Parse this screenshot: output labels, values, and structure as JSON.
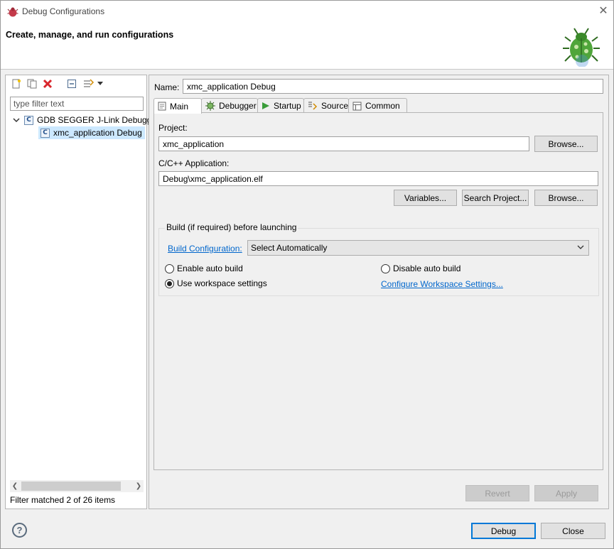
{
  "window": {
    "title": "Debug Configurations",
    "close_glyph": "✕"
  },
  "banner": {
    "heading": "Create, manage, and run configurations"
  },
  "left": {
    "toolbar": [
      "new-config-icon",
      "duplicate-icon",
      "delete-icon",
      "collapse-all-icon",
      "filter-icon",
      "chevron-down-icon"
    ],
    "filter_placeholder": "type filter text",
    "tree": [
      {
        "label": "GDB SEGGER J-Link Debugging",
        "type_glyph": "C",
        "expanded": true,
        "depth": 0
      },
      {
        "label": "xmc_application Debug",
        "type_glyph": "C",
        "selected": true,
        "depth": 1
      }
    ],
    "status": "Filter matched 2 of 26 items"
  },
  "right": {
    "name_label": "Name:",
    "name_value": "xmc_application Debug",
    "tabs": [
      {
        "label": "Main",
        "icon": "main-tab-icon",
        "active": true
      },
      {
        "label": "Debugger",
        "icon": "debugger-gear-icon"
      },
      {
        "label": "Startup",
        "icon": "startup-play-icon"
      },
      {
        "label": "Source",
        "icon": "source-icon"
      },
      {
        "label": "Common",
        "icon": "common-icon"
      }
    ],
    "project_label": "Project:",
    "project_value": "xmc_application",
    "browse_label": "Browse...",
    "app_label": "C/C++ Application:",
    "app_value": "Debug\\xmc_application.elf",
    "variables_label": "Variables...",
    "search_project_label": "Search Project...",
    "build_group": {
      "title": "Build (if required) before launching",
      "build_config_link": "Build Configuration:",
      "build_config_value": "Select Automatically",
      "enable_auto": "Enable auto build",
      "disable_auto": "Disable auto build",
      "use_workspace": "Use workspace settings",
      "configure_link": "Configure Workspace Settings...",
      "selected_option": "use_workspace"
    },
    "revert_label": "Revert",
    "apply_label": "Apply"
  },
  "footer": {
    "help_glyph": "?",
    "debug_label": "Debug",
    "close_label": "Close"
  },
  "colors": {
    "accent": "#0078d7",
    "link": "#0066cc",
    "selection": "#cce8ff"
  }
}
